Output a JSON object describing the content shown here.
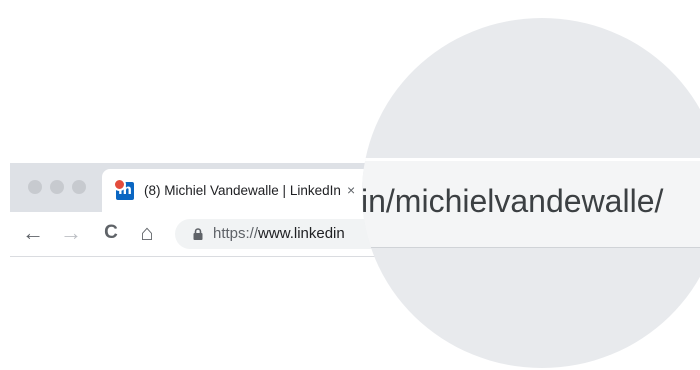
{
  "browser": {
    "tab": {
      "favicon_text": "in",
      "title": "(8) Michiel Vandewalle | LinkedIn",
      "close_glyph": "×"
    },
    "nav": {
      "back": "←",
      "forward": "→",
      "reload": "C",
      "home": "⌂"
    },
    "address_bar": {
      "scheme": "https://",
      "host": "www.linkedin"
    }
  },
  "magnifier": {
    "text": "in/michielvandewalle/"
  },
  "colors": {
    "linkedin_blue": "#0a66c2",
    "notification_red": "#e34c3c",
    "tabstrip_bg": "#dee1e6"
  }
}
